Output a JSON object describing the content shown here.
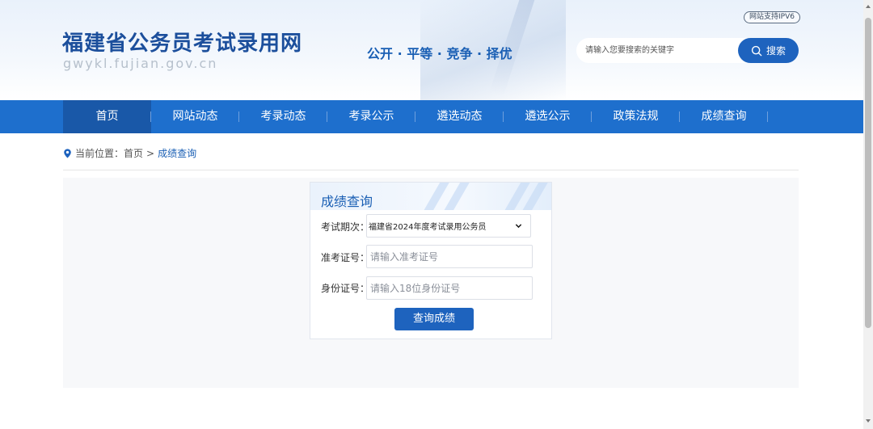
{
  "header": {
    "site_title": "福建省公务员考试录用网",
    "site_domain": "gwykl.fujian.gov.cn",
    "slogan": "公开 · 平等 · 竞争 · 择优",
    "ipv6_badge": "网站支持IPV6",
    "search": {
      "placeholder": "请输入您要搜索的关键字",
      "button_label": "搜索",
      "icon": "search-icon"
    }
  },
  "nav": {
    "items": [
      {
        "label": "首页",
        "active": true
      },
      {
        "label": "网站动态"
      },
      {
        "label": "考录动态"
      },
      {
        "label": "考录公示"
      },
      {
        "label": "遴选动态"
      },
      {
        "label": "遴选公示"
      },
      {
        "label": "政策法规"
      },
      {
        "label": "成绩查询"
      }
    ]
  },
  "breadcrumb": {
    "icon": "location-pin-icon",
    "prefix": "当前位置：",
    "home": "首页",
    "separator": ">",
    "current": "成绩查询"
  },
  "query_form": {
    "title": "成绩查询",
    "exam_period_label": "考试期次：",
    "exam_period_selected": "福建省2024年度考试录用公务员",
    "ticket_label": "准考证号：",
    "ticket_placeholder": "请输入准考证号",
    "id_label": "身份证号：",
    "id_placeholder": "请输入18位身份证号",
    "submit_label": "查询成绩"
  },
  "colors": {
    "brand_blue": "#1e6fcd",
    "title_blue": "#1c4f9c",
    "button_blue": "#1e63be",
    "nav_active": "#1958a8"
  }
}
